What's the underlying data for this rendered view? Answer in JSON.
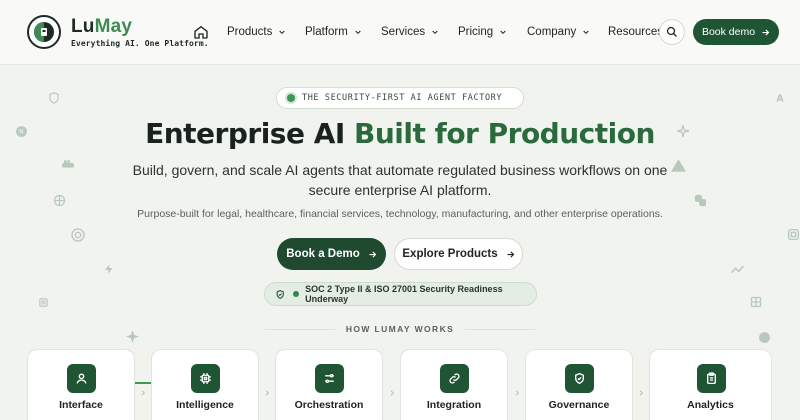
{
  "header": {
    "brand_part1": "Lu",
    "brand_part2": "May",
    "tagline": "Everything AI. One Platform.",
    "nav": [
      {
        "label": "Products"
      },
      {
        "label": "Platform"
      },
      {
        "label": "Services"
      },
      {
        "label": "Pricing"
      },
      {
        "label": "Company"
      },
      {
        "label": "Resources"
      }
    ],
    "cta_label": "Book demo"
  },
  "hero": {
    "eyebrow": "THE SECURITY-FIRST AI AGENT FACTORY",
    "title_plain": "Enterprise AI ",
    "title_accent": "Built for Production",
    "subtitle": "Build, govern, and scale AI agents that automate regulated business workflows on one secure enterprise AI platform.",
    "small_text": "Purpose-built for legal, healthcare, financial services, technology, manufacturing, and other enterprise operations.",
    "primary_button": "Book a Demo",
    "secondary_button": "Explore Products",
    "badge": "SOC 2 Type II & ISO 27001 Security Readiness Underway"
  },
  "how_it_works": {
    "heading": "HOW LUMAY WORKS",
    "steps": [
      {
        "label": "Interface",
        "icon": "user-icon"
      },
      {
        "label": "Intelligence",
        "icon": "chip-icon"
      },
      {
        "label": "Orchestration",
        "icon": "sliders-icon"
      },
      {
        "label": "Integration",
        "icon": "link-icon"
      },
      {
        "label": "Governance",
        "icon": "shield-check-icon"
      },
      {
        "label": "Analytics",
        "icon": "clipboard-icon"
      }
    ]
  },
  "colors": {
    "brand_dark": "#1f5533",
    "brand_accent": "#3f8a55",
    "background": "#f1f3ee"
  }
}
